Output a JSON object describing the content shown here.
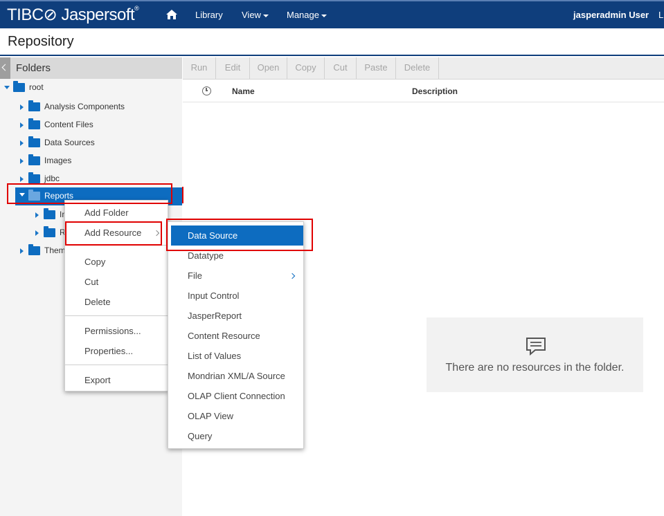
{
  "header": {
    "brand_main": "TIBC⊘ Jaspersoft",
    "brand_tm": "®",
    "nav": [
      "Library",
      "View",
      "Manage"
    ],
    "user": "jasperadmin User",
    "logout_truncated": "L"
  },
  "page": {
    "title": "Repository"
  },
  "sidebar": {
    "title": "Folders",
    "root": "root",
    "folders": [
      "Analysis Components",
      "Content Files",
      "Data Sources",
      "Images",
      "jdbc",
      "Reports",
      "Themes"
    ],
    "reports_children_truncated": [
      "In",
      "R"
    ],
    "themes_truncated": "Them"
  },
  "toolbar": {
    "buttons": [
      "Run",
      "Edit",
      "Open",
      "Copy",
      "Cut",
      "Paste",
      "Delete"
    ]
  },
  "table": {
    "columns": [
      "Name",
      "Description"
    ]
  },
  "empty_state": {
    "message": "There are no resources in the folder."
  },
  "context_menu": {
    "items": [
      "Add Folder",
      "Add Resource",
      "Copy",
      "Cut",
      "Delete",
      "Permissions...",
      "Properties...",
      "Export"
    ]
  },
  "submenu": {
    "items": [
      "Data Source",
      "Datatype",
      "File",
      "Input Control",
      "JasperReport",
      "Content Resource",
      "List of Values",
      "Mondrian XML/A Source",
      "OLAP Client Connection",
      "OLAP View",
      "Query"
    ],
    "active": "Data Source"
  },
  "colors": {
    "header_bg": "#0f3e7c",
    "selection": "#0d6cc0",
    "highlight": "#e00000"
  },
  "icons": [
    "home-icon",
    "folder-icon",
    "clock-icon",
    "message-icon",
    "chevron-right-icon"
  ]
}
